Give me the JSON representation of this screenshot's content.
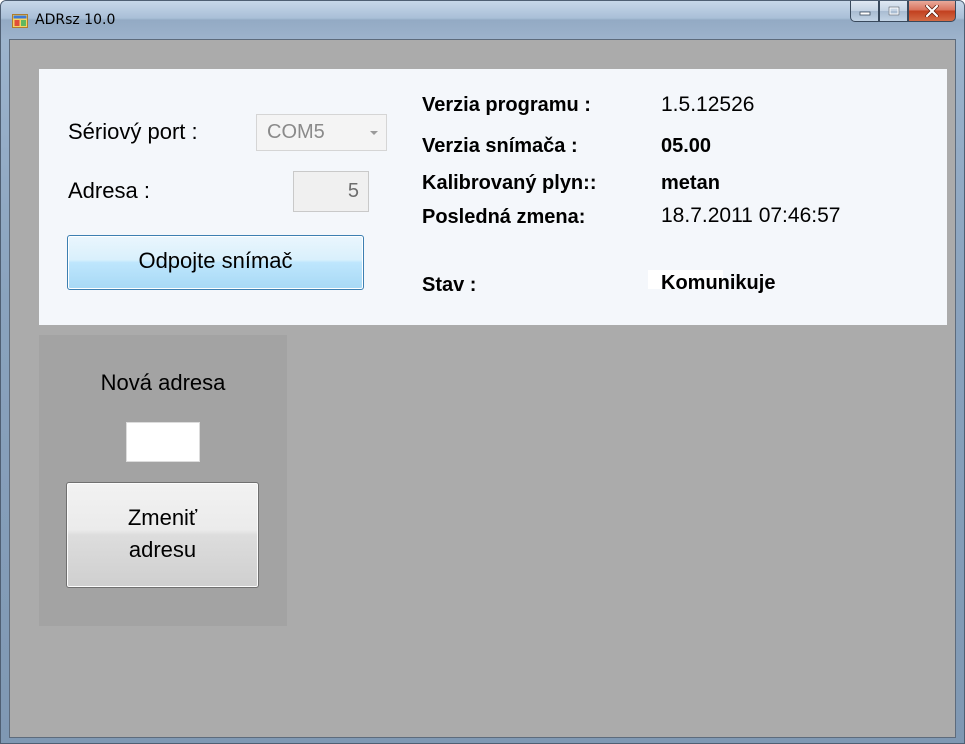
{
  "window": {
    "title": "ADRsz 10.0"
  },
  "connection": {
    "serial_port_label": "Sériový port :",
    "serial_port_value": "COM5",
    "address_label": "Adresa :",
    "address_value": "5",
    "disconnect_button": "Odpojte snímač"
  },
  "info": {
    "program_version_label": "Verzia programu :",
    "program_version_value": "1.5.12526",
    "sensor_version_label": "Verzia snímača :",
    "sensor_version_value": "05.00",
    "calibrated_gas_label": "Kalibrovaný plyn::",
    "calibrated_gas_value": "metan",
    "last_change_label": "Posledná zmena:",
    "last_change_value": "18.7.2011 07:46:57",
    "status_label": "Stav :",
    "status_value": "Komunikuje"
  },
  "new_address": {
    "title": "Nová adresa",
    "input_value": "",
    "change_button_line1": "Zmeniť",
    "change_button_line2": "adresu"
  },
  "colors": {
    "client_background": "#ababab",
    "top_panel_background": "#f4f7fb",
    "side_panel_background": "#a3a3a3",
    "close_button": "#c2401f",
    "primary_button_border": "#3c7fb1"
  },
  "icons": {
    "app": "app-window-icon",
    "minimize": "minimize-icon",
    "maximize": "maximize-icon",
    "close": "close-icon",
    "dropdown": "chevron-down-icon"
  }
}
